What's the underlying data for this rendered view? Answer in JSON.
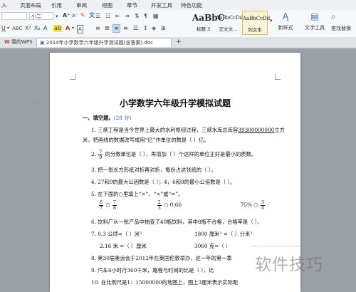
{
  "menu": {
    "items": [
      "入",
      "页面布局",
      "引用",
      "审阅",
      "视图",
      "章节",
      "开发工具",
      "特色功能"
    ]
  },
  "ribbon": {
    "font_name": "",
    "font_size": "小二",
    "styles": [
      {
        "sample": "AaBbC",
        "caption": "标题 3",
        "selected": false
      },
      {
        "sample": "AaBbCcDd",
        "caption": "正文文...",
        "selected": false
      },
      {
        "sample": "AaBbCcDd",
        "caption": "列文本",
        "selected": true
      }
    ],
    "new_style_label": "新样式",
    "text_tools_label": "文字工具",
    "find_replace_label": "查找替换"
  },
  "tabs": [
    {
      "label": "我的WPS",
      "active": false
    },
    {
      "label": "2014年小学数学六年级升学测试题(含答案).doc",
      "active": true
    }
  ],
  "tab_add": "+",
  "document": {
    "title": "小学数学六年级升学模拟试题",
    "section1_heading": "一、填空题。",
    "section1_score": "(28 分)",
    "q1_line1": "1. 三峡工程是当今世界上最大的水利枢纽过程，三峡水库总库容",
    "q1_number": "39300000000",
    "q1_line1_end": "立方",
    "q1_line2": "米，把画线的数据改写成用“亿”作单位的数是（        ）亿。",
    "q2_pre": "2.",
    "q2_frac_num": "7",
    "q2_frac_den": "9",
    "q2_post": "的分数单位是（      ），再增加（      ）个这样的单位正好是最小的质数。",
    "q3": "3. 把一张长方形纸对折再对折，每份占这张纸的（      ）。",
    "q4": "4. 27和9的最大公因数是（      ）；4，6和8的最小公倍数是（      ）。",
    "q5": "5. 在下面的○里填上“>”、“<”或“=”。",
    "q5_items": [
      {
        "a_num": "6",
        "a_den": "7",
        "b_num": "7",
        "b_den": "8"
      },
      {
        "a_num": "2",
        "a_den": "3",
        "b_text": "0.66"
      },
      {
        "a_text": "75%",
        "b_num": "3",
        "b_den": "4"
      }
    ],
    "q5_circle": "○",
    "q6": "6. 饮料厂从一批产品中抽查了40瓶饮料，其中8瓶不合格，合格率是（      ）。",
    "q7_a": "7. 0.3 公顷=（      ）米²",
    "q7_b": "1800 厘米² =（      ）分米²",
    "q7_c": "2.16 米 =（      ）厘米",
    "q7_d": "3060 克=（      ）",
    "q8": "8. 第30届奥运会于2012年在英国伦敦举办，这一年的第一季",
    "q9": "9. 汽车4小时行360千米，路程与时间的比是（      ），比",
    "q10": "10. 在比例尺是1：15000000的地图上，图上3厘米表示实际距"
  },
  "watermark": "软件技巧"
}
